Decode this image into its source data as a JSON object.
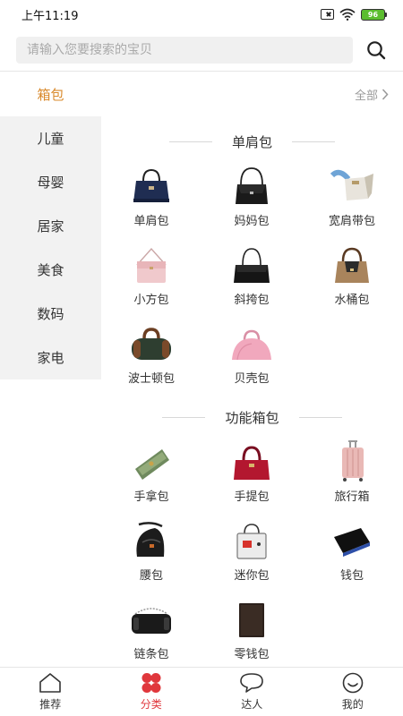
{
  "status_bar": {
    "time": "上午11:19",
    "battery": "96"
  },
  "search": {
    "placeholder": "请输入您要搜索的宝贝"
  },
  "sidebar": {
    "items": [
      {
        "label": "箱包",
        "active": true
      },
      {
        "label": "儿童"
      },
      {
        "label": "母婴"
      },
      {
        "label": "居家"
      },
      {
        "label": "美食"
      },
      {
        "label": "数码"
      },
      {
        "label": "家电"
      }
    ]
  },
  "content": {
    "all_label": "全部",
    "sections": [
      {
        "title": "单肩包",
        "items": [
          {
            "label": "单肩包",
            "icon": "navy-tote-bag-icon"
          },
          {
            "label": "妈妈包",
            "icon": "black-shoulder-bag-icon"
          },
          {
            "label": "宽肩带包",
            "icon": "wide-strap-bag-icon"
          },
          {
            "label": "小方包",
            "icon": "pink-square-bag-icon"
          },
          {
            "label": "斜挎包",
            "icon": "black-crossbody-bag-icon"
          },
          {
            "label": "水桶包",
            "icon": "bucket-bag-icon"
          },
          {
            "label": "波士顿包",
            "icon": "boston-bag-icon"
          },
          {
            "label": "贝壳包",
            "icon": "pink-shell-bag-icon"
          }
        ]
      },
      {
        "title": "功能箱包",
        "items": [
          {
            "label": "手拿包",
            "icon": "green-clutch-icon"
          },
          {
            "label": "手提包",
            "icon": "red-handbag-icon"
          },
          {
            "label": "旅行箱",
            "icon": "pink-suitcase-icon"
          },
          {
            "label": "腰包",
            "icon": "waist-bag-icon"
          },
          {
            "label": "迷你包",
            "icon": "mini-bag-icon"
          },
          {
            "label": "钱包",
            "icon": "wallet-icon"
          },
          {
            "label": "链条包",
            "icon": "chain-bag-icon"
          },
          {
            "label": "零钱包",
            "icon": "coin-purse-icon"
          }
        ]
      }
    ]
  },
  "tabs": [
    {
      "label": "推荐",
      "icon": "home-icon"
    },
    {
      "label": "分类",
      "icon": "category-icon",
      "active": true
    },
    {
      "label": "达人",
      "icon": "chat-bubble-icon"
    },
    {
      "label": "我的",
      "icon": "smiley-profile-icon"
    }
  ],
  "colors": {
    "accent_sidebar": "#d9892b",
    "accent_tab": "#e0373c",
    "sidebar_bg": "#f2f2f2"
  }
}
